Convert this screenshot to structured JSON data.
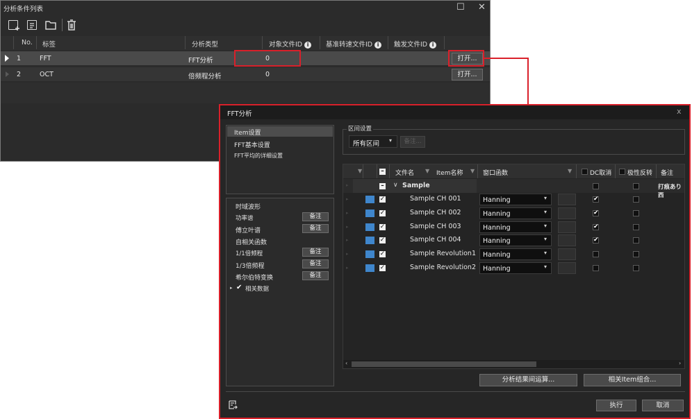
{
  "list_window": {
    "title": "分析条件列表",
    "controls": {
      "maximize": "☐",
      "close": "✕"
    },
    "toolbar_icons": [
      "add-item-icon",
      "add-copy-icon",
      "folder-icon",
      "trash-icon"
    ],
    "columns": [
      "No.",
      "标签",
      "分析类型",
      "对象文件ID",
      "基准转速文件ID",
      "触发文件ID"
    ],
    "rows": [
      {
        "no": "1",
        "label": "FFT",
        "type": "FFT分析",
        "target_id": "0",
        "ref_id": "",
        "trigger_id": "",
        "open": "打开..."
      },
      {
        "no": "2",
        "label": "OCT",
        "type": "倍频程分析",
        "target_id": "0",
        "ref_id": "",
        "trigger_id": "",
        "open": "打开..."
      }
    ]
  },
  "fft_window": {
    "title": "FFT分析",
    "close": "x",
    "nav": [
      "Item设置",
      "FFT基本设置",
      "FFT平均的详细设置"
    ],
    "waveform": {
      "title": "时域波形",
      "items": [
        {
          "label": "功率谱",
          "btn": "备注"
        },
        {
          "label": "傅立叶谱",
          "btn": "备注"
        },
        {
          "label": "自相关函数",
          "btn": ""
        },
        {
          "label": "1/1倍频程",
          "btn": "备注"
        },
        {
          "label": "1/3倍频程",
          "btn": "备注"
        },
        {
          "label": "希尔伯特变换",
          "btn": "备注"
        }
      ],
      "correlation": "相关数据"
    },
    "interval": {
      "legend": "区间设置",
      "value": "所有区间",
      "btn": "备注..."
    },
    "grid": {
      "headers": [
        "文件名",
        "Item名称",
        "窗口函数",
        "DC取消",
        "极性反转",
        "备注"
      ],
      "group": {
        "name": "Sample",
        "note": "打痕あり西"
      },
      "rows": [
        {
          "name": "Sample CH 001",
          "window": "Hanning",
          "dc": true
        },
        {
          "name": "Sample CH 002",
          "window": "Hanning",
          "dc": true
        },
        {
          "name": "Sample CH 003",
          "window": "Hanning",
          "dc": true
        },
        {
          "name": "Sample CH 004",
          "window": "Hanning",
          "dc": true
        },
        {
          "name": "Sample Revolution1",
          "window": "Hanning",
          "dc": false
        },
        {
          "name": "Sample Revolution2",
          "window": "Hanning",
          "dc": false
        }
      ]
    },
    "buttons": {
      "calc": "分析结果间运算...",
      "combo": "相关Item组合...",
      "execute": "执行",
      "cancel": "取消"
    },
    "colors": {
      "accent_red": "#d9202a",
      "item_blue": "#3f86cc"
    }
  }
}
